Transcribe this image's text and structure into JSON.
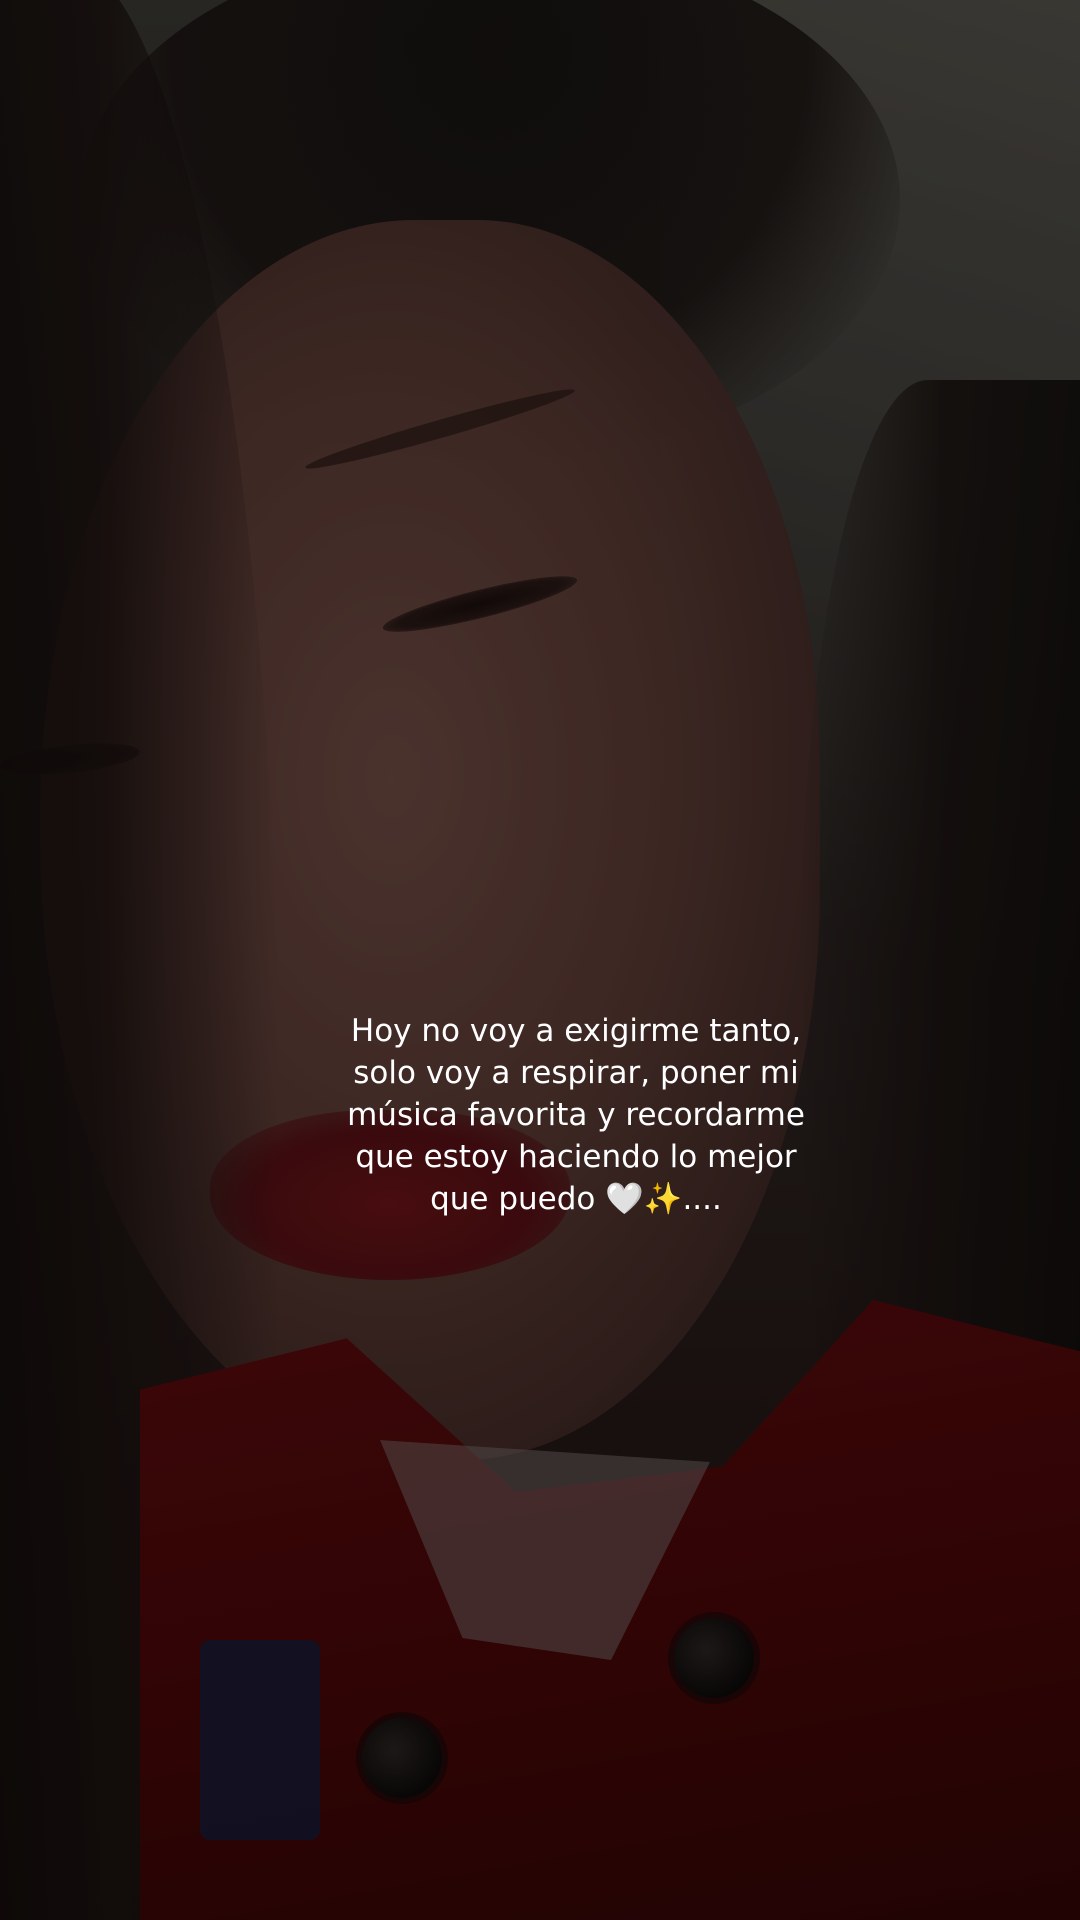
{
  "caption": {
    "lines": [
      "Hoy no voy a exigirme tanto,",
      "solo voy a respirar, poner mi",
      "música favorita y recordarme",
      "que estoy haciendo lo mejor",
      "que puedo 🤍✨...."
    ]
  },
  "colors": {
    "caption_text": "#ffffff",
    "shirt": "#5a0a0e",
    "background": "#1a1412"
  }
}
